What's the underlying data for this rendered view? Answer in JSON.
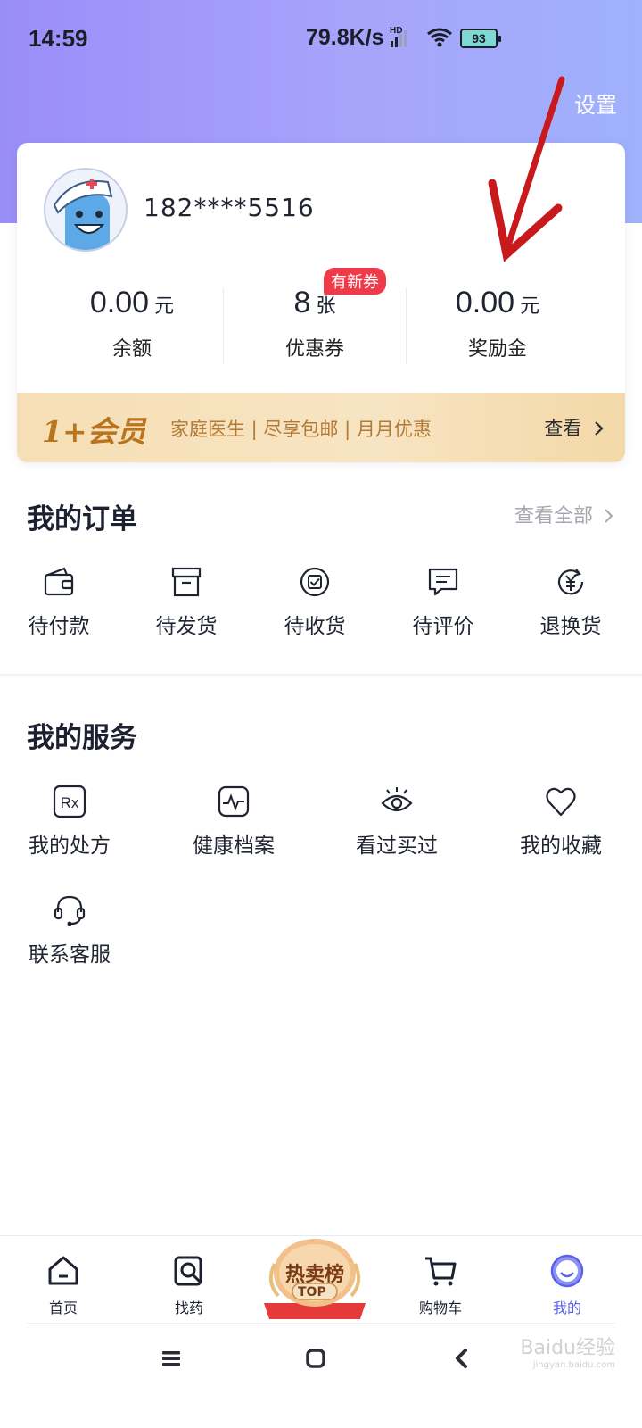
{
  "status_bar": {
    "time": "14:59",
    "network_speed": "79.8K/s",
    "hd": "HD",
    "battery": "93"
  },
  "header": {
    "settings_label": "设置"
  },
  "account": {
    "phone": "182****5516",
    "stats": [
      {
        "value": "0.00",
        "unit": "元",
        "label": "余额"
      },
      {
        "value": "8",
        "unit": "张",
        "label": "优惠券",
        "badge": "有新券"
      },
      {
        "value": "0.00",
        "unit": "元",
        "label": "奖励金"
      }
    ],
    "member": {
      "logo": "1+会员",
      "perks": "家庭医生 | 尽享包邮 | 月月优惠",
      "view_label": "查看"
    }
  },
  "orders": {
    "title": "我的订单",
    "view_all": "查看全部",
    "items": [
      {
        "label": "待付款",
        "icon": "wallet-icon"
      },
      {
        "label": "待发货",
        "icon": "box-icon"
      },
      {
        "label": "待收货",
        "icon": "receive-icon"
      },
      {
        "label": "待评价",
        "icon": "comment-icon"
      },
      {
        "label": "退换货",
        "icon": "refund-icon"
      }
    ]
  },
  "services": {
    "title": "我的服务",
    "items": [
      {
        "label": "我的处方",
        "icon": "rx-icon"
      },
      {
        "label": "健康档案",
        "icon": "health-record-icon"
      },
      {
        "label": "看过买过",
        "icon": "eye-icon"
      },
      {
        "label": "我的收藏",
        "icon": "heart-icon"
      },
      {
        "label": "联系客服",
        "icon": "headset-icon"
      }
    ]
  },
  "bottom_nav": {
    "items": [
      {
        "label": "首页",
        "icon": "home-icon"
      },
      {
        "label": "找药",
        "icon": "find-medicine-icon"
      },
      {
        "label": "购物车",
        "icon": "cart-icon"
      },
      {
        "label": "我的",
        "icon": "profile-icon",
        "active": true
      }
    ],
    "hot": {
      "label": "热卖榜",
      "sub": "TOP"
    }
  },
  "watermark": {
    "text": "Baidu经验",
    "sub": "jingyan.baidu.com"
  },
  "colors": {
    "header_gradient_start": "#9a8df8",
    "header_gradient_end": "#9fb1fb",
    "active_nav": "#5c63e8",
    "badge_red": "#ef3a4a",
    "member_gold": "#b8741f",
    "annotation_arrow": "#c8191d"
  }
}
